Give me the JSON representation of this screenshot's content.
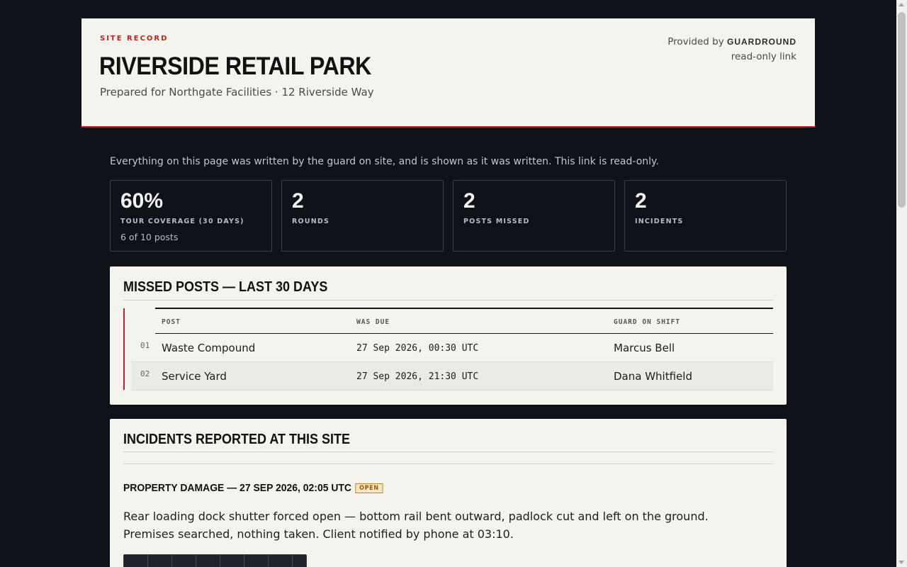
{
  "header": {
    "kicker": "SITE RECORD",
    "site_name": "RIVERSIDE RETAIL PARK",
    "subtitle": "Prepared for Northgate Facilities · 12 Riverside Way",
    "provided_prefix": "Provided by",
    "provider": "GUARDROUND",
    "link_note": "read-only link"
  },
  "intro": "Everything on this page was written by the guard on site, and is shown as it was written. This link is read-only.",
  "stats": [
    {
      "value": "60%",
      "label": "TOUR COVERAGE (30 DAYS)",
      "sub": "6 of 10 posts"
    },
    {
      "value": "2",
      "label": "ROUNDS",
      "sub": ""
    },
    {
      "value": "2",
      "label": "POSTS MISSED",
      "sub": ""
    },
    {
      "value": "2",
      "label": "INCIDENTS",
      "sub": ""
    }
  ],
  "missed": {
    "title": "MISSED POSTS — LAST 30 DAYS",
    "columns": [
      "POST",
      "WAS DUE",
      "GUARD ON SHIFT"
    ],
    "rows": [
      {
        "num": "01",
        "post": "Waste Compound",
        "due": "27 Sep 2026, 00:30 UTC",
        "guard": "Marcus Bell"
      },
      {
        "num": "02",
        "post": "Service Yard",
        "due": "27 Sep 2026, 21:30 UTC",
        "guard": "Dana Whitfield"
      }
    ]
  },
  "incidents": {
    "title": "INCIDENTS REPORTED AT THIS SITE",
    "items": [
      {
        "heading": "PROPERTY DAMAGE — 27 SEP 2026, 02:05 UTC",
        "status": "OPEN",
        "text": "Rear loading dock shutter forced open — bottom rail bent outward, padlock cut and left on the ground. Premises searched, nothing taken. Client notified by phone at 03:10."
      }
    ]
  },
  "colors": {
    "accent": "#b3261e",
    "page_bg": "#0e1117",
    "card_bg": "#f4f3ee",
    "badge_open": "#f7e6c4"
  }
}
